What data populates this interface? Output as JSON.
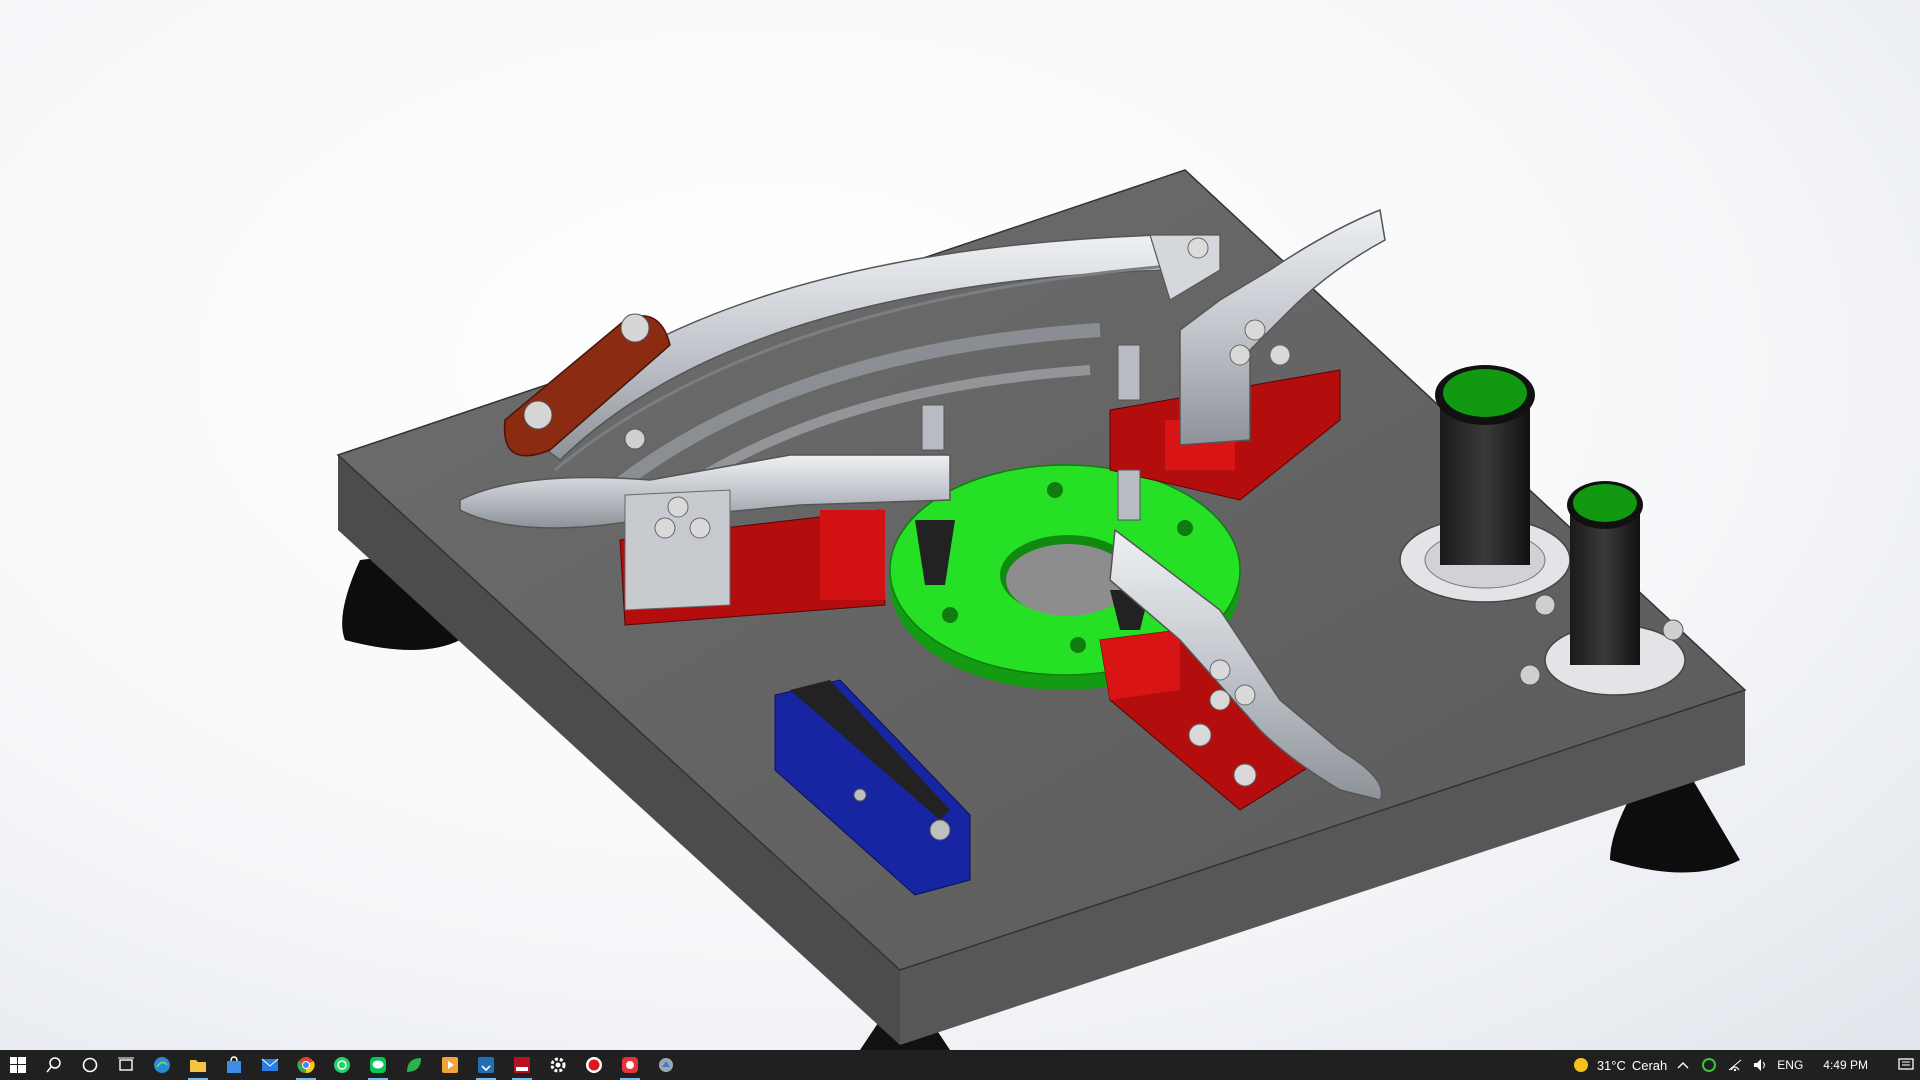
{
  "window": {
    "app": "SolidWorks 3D model viewport",
    "scene": "fixture-plate-assembly"
  },
  "colors": {
    "plate_top": "#646464",
    "plate_side": "#4a4a4a",
    "green_part": "#22dd22",
    "red_block": "#bb0e0e",
    "blue_block": "#1a26a8",
    "steel": "#c6c9ce",
    "taskbar_bg": "#202020"
  },
  "taskbar": {
    "apps": [
      {
        "name": "windows-start",
        "icon": "windows-logo-icon"
      },
      {
        "name": "search",
        "icon": "search-icon"
      },
      {
        "name": "cortana",
        "icon": "cortana-icon"
      },
      {
        "name": "task-view",
        "icon": "task-view-icon"
      },
      {
        "name": "edge",
        "icon": "edge-icon"
      },
      {
        "name": "file-explorer",
        "icon": "folder-icon"
      },
      {
        "name": "store",
        "icon": "store-icon"
      },
      {
        "name": "mail",
        "icon": "mail-icon"
      },
      {
        "name": "chrome",
        "icon": "chrome-icon"
      },
      {
        "name": "whatsapp",
        "icon": "whatsapp-icon"
      },
      {
        "name": "line",
        "icon": "line-icon"
      },
      {
        "name": "app-green",
        "icon": "leaf-icon"
      },
      {
        "name": "app-orange",
        "icon": "media-icon"
      },
      {
        "name": "app-installer",
        "icon": "installer-icon"
      },
      {
        "name": "solidworks-2019",
        "icon": "solidworks-icon"
      },
      {
        "name": "settings",
        "icon": "gear-icon"
      },
      {
        "name": "recorder",
        "icon": "record-icon"
      },
      {
        "name": "app-red",
        "icon": "red-app-icon"
      },
      {
        "name": "app-misc",
        "icon": "misc-app-icon"
      }
    ],
    "tray": {
      "weather_temp": "31°C",
      "weather_desc": "Cerah",
      "language": "ENG",
      "time": "4:49 PM"
    }
  }
}
